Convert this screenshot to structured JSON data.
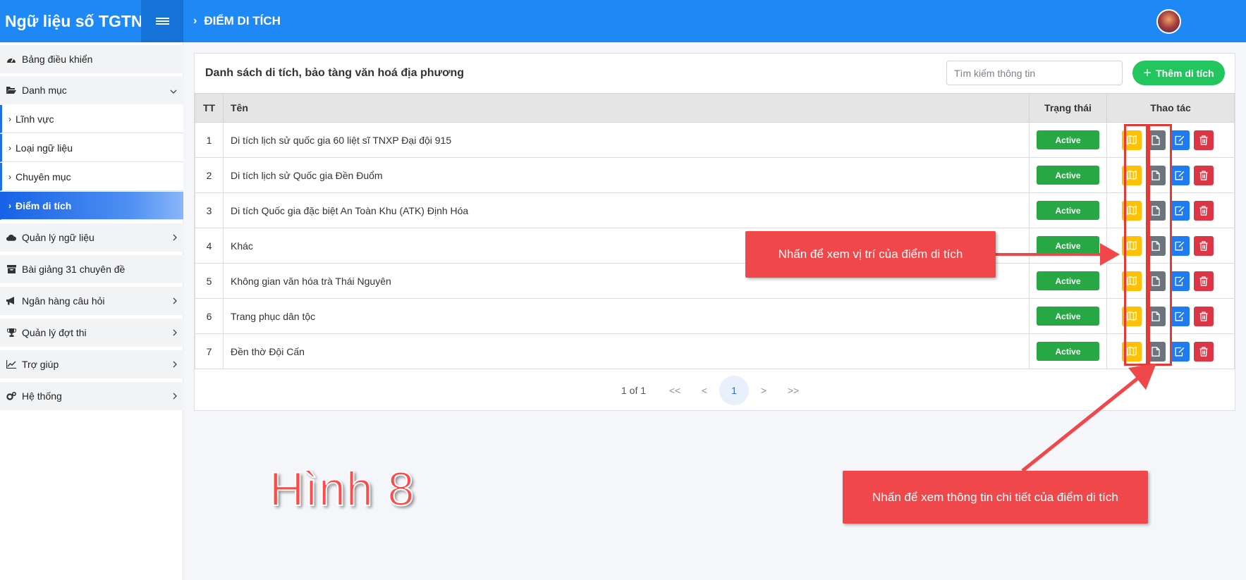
{
  "app": {
    "title": "Ngữ liệu số TGTN"
  },
  "header": {
    "breadcrumb": "ĐIỂM DI TÍCH"
  },
  "sidebar": {
    "items": [
      {
        "label": "Bảng điều khiển",
        "icon": "dashboard-icon",
        "arrow": ""
      },
      {
        "label": "Danh mục",
        "icon": "folder-open-icon",
        "arrow": "chevron-down"
      },
      {
        "label": "Quản lý ngữ liệu",
        "icon": "cloud-icon",
        "arrow": "chevron-right"
      },
      {
        "label": "Bài giảng 31 chuyên đề",
        "icon": "archive-icon",
        "arrow": ""
      },
      {
        "label": "Ngân hàng câu hỏi",
        "icon": "megaphone-icon",
        "arrow": "chevron-right"
      },
      {
        "label": "Quản lý đợt thi",
        "icon": "trophy-icon",
        "arrow": "chevron-right"
      },
      {
        "label": "Trợ giúp",
        "icon": "chart-line-icon",
        "arrow": "chevron-right"
      },
      {
        "label": "Hệ thống",
        "icon": "cogs-icon",
        "arrow": "chevron-right"
      }
    ],
    "subitems": [
      {
        "label": "Lĩnh vực"
      },
      {
        "label": "Loại ngữ liệu"
      },
      {
        "label": "Chuyên mục"
      },
      {
        "label": "Điểm di tích"
      }
    ]
  },
  "main": {
    "card_title": "Danh sách di tích, bảo tàng văn hoá địa phương",
    "search_placeholder": "Tìm kiếm thông tin",
    "add_button": "Thêm di tích",
    "columns": [
      "TT",
      "Tên",
      "Trạng thái",
      "Thao tác"
    ],
    "rows": [
      {
        "tt": "1",
        "name": "Di tích lịch sử quốc gia 60 liệt sĩ TNXP Đại đội 915",
        "status": "Active"
      },
      {
        "tt": "2",
        "name": "Di tích lịch sử Quốc gia Đền Đuổm",
        "status": "Active"
      },
      {
        "tt": "3",
        "name": "Di tích Quốc gia đặc biệt An Toàn Khu (ATK) Định Hóa",
        "status": "Active"
      },
      {
        "tt": "4",
        "name": "Khác",
        "status": "Active"
      },
      {
        "tt": "5",
        "name": "Không gian văn hóa trà Thái Nguyên",
        "status": "Active"
      },
      {
        "tt": "6",
        "name": "Trang phục dân tộc",
        "status": "Active"
      },
      {
        "tt": "7",
        "name": "Đền thờ Đội Cấn",
        "status": "Active"
      }
    ],
    "row_actions": [
      "map-icon",
      "file-icon",
      "edit-icon",
      "trash-icon"
    ],
    "pagination": {
      "info": "1 of 1",
      "first": "<<",
      "prev": "<",
      "current": "1",
      "next": ">",
      "last": ">>"
    }
  },
  "annotations": {
    "callout_map": "Nhấn để xem vị trí của điểm di tích",
    "callout_detail": "Nhấn để xem thông tin chi tiết của điểm di tích",
    "figure_label": "Hình 8"
  },
  "colors": {
    "topbar": "#1e88f5",
    "status_active": "#28a745",
    "add_button": "#22c55e",
    "btn_map": "#ffc107",
    "btn_detail": "#6c757d",
    "btn_edit": "#1e7cf0",
    "btn_delete": "#dc3545",
    "annotation": "#f0484a"
  }
}
